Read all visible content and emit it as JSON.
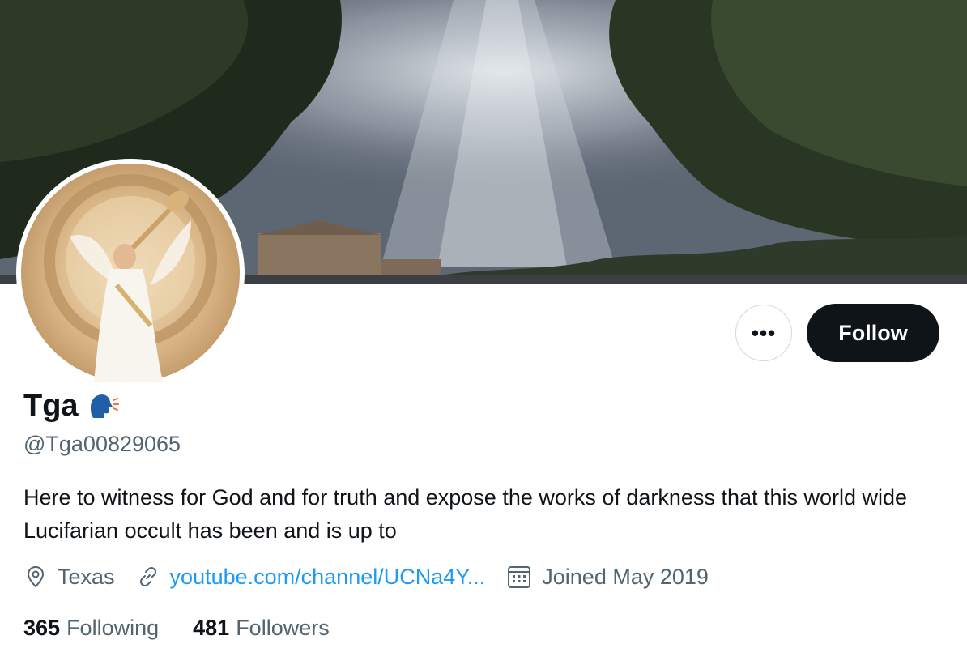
{
  "profile": {
    "display_name": "Tga",
    "name_emoji_icon": "speaking-head-icon",
    "handle": "@Tga00829065",
    "bio": "Here to witness for God and for truth and expose the works of darkness that this world wide Lucifarian occult has been and is up to",
    "location": "Texas",
    "location_icon": "location-pin-icon",
    "website": "youtube.com/channel/UCNa4Y...",
    "website_icon": "link-icon",
    "joined": "Joined May 2019",
    "joined_icon": "calendar-icon"
  },
  "actions": {
    "more_label": "•••",
    "follow_label": "Follow"
  },
  "stats": {
    "following_count": "365",
    "following_label": "Following",
    "followers_count": "481",
    "followers_label": "Followers"
  },
  "colors": {
    "text_primary": "#0f1419",
    "text_secondary": "#536471",
    "link": "#1d9bf0",
    "follow_button_bg": "#0f1419"
  }
}
